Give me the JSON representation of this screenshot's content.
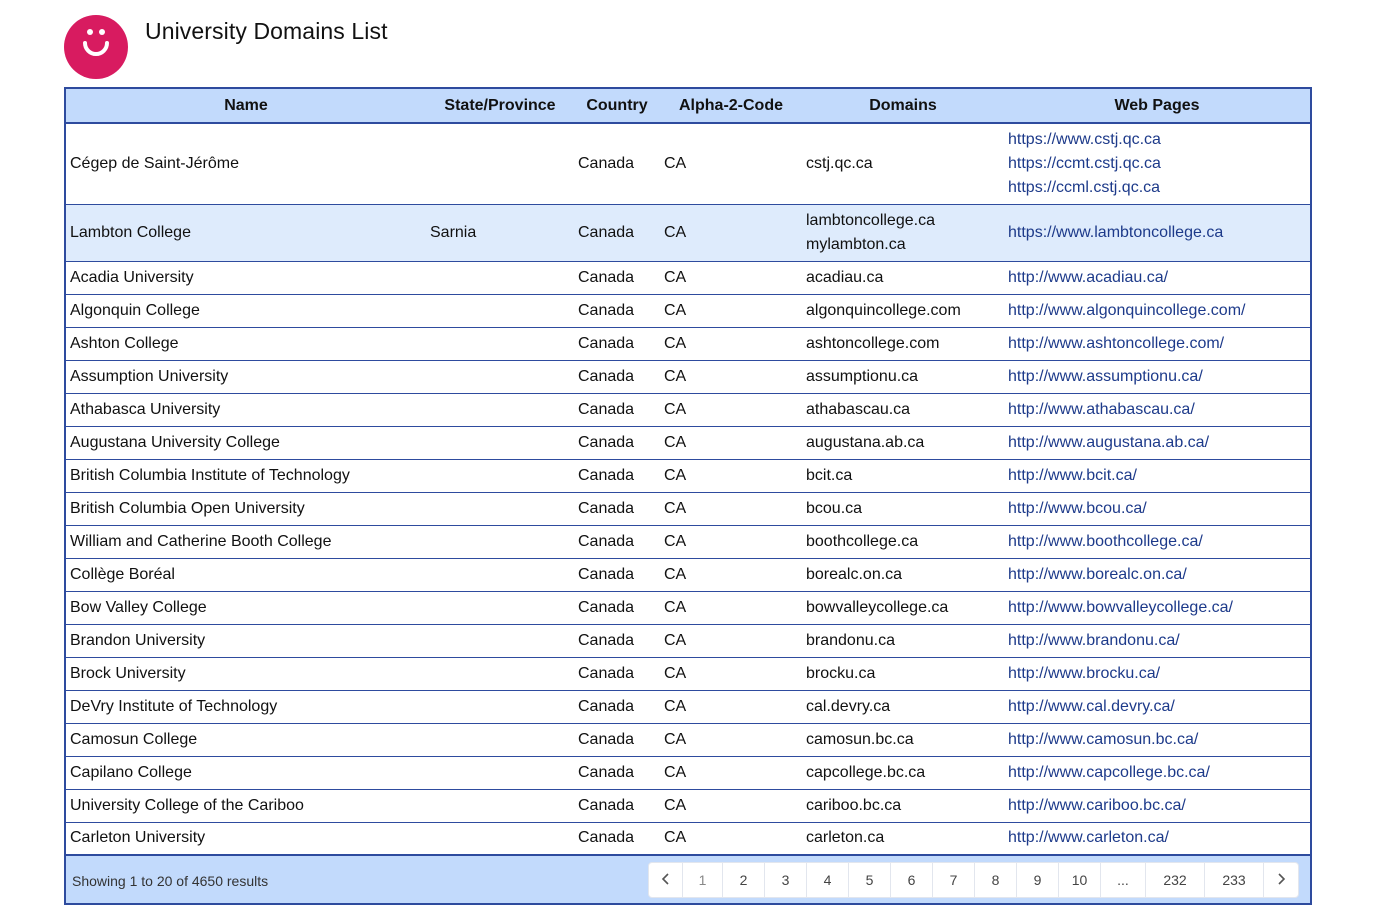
{
  "app": {
    "title": "University Domains List",
    "brand_color": "#d81b60"
  },
  "icons": {
    "logo": "smiley-logo-icon",
    "prev": "chevron-left-icon",
    "next": "chevron-right-icon"
  },
  "colors": {
    "header_bg": "#c2dafc",
    "border": "#2e4b9e",
    "highlight_row": "#deebfc",
    "link": "#1d3a8a"
  },
  "table": {
    "headers": [
      "Name",
      "State/Province",
      "Country",
      "Alpha-2-Code",
      "Domains",
      "Web Pages"
    ],
    "rows": [
      {
        "name": "Cégep de Saint-Jérôme",
        "state": "",
        "country": "Canada",
        "code": "CA",
        "domains": [
          "cstj.qc.ca"
        ],
        "web_pages": [
          "https://www.cstj.qc.ca",
          "https://ccmt.cstj.qc.ca",
          "https://ccml.cstj.qc.ca"
        ]
      },
      {
        "name": "Lambton College",
        "state": "Sarnia",
        "country": "Canada",
        "code": "CA",
        "domains": [
          "lambtoncollege.ca",
          "mylambton.ca"
        ],
        "web_pages": [
          "https://www.lambtoncollege.ca"
        ]
      },
      {
        "name": "Acadia University",
        "state": "",
        "country": "Canada",
        "code": "CA",
        "domains": [
          "acadiau.ca"
        ],
        "web_pages": [
          "http://www.acadiau.ca/"
        ]
      },
      {
        "name": "Algonquin College",
        "state": "",
        "country": "Canada",
        "code": "CA",
        "domains": [
          "algonquincollege.com"
        ],
        "web_pages": [
          "http://www.algonquincollege.com/"
        ]
      },
      {
        "name": "Ashton College",
        "state": "",
        "country": "Canada",
        "code": "CA",
        "domains": [
          "ashtoncollege.com"
        ],
        "web_pages": [
          "http://www.ashtoncollege.com/"
        ]
      },
      {
        "name": "Assumption University",
        "state": "",
        "country": "Canada",
        "code": "CA",
        "domains": [
          "assumptionu.ca"
        ],
        "web_pages": [
          "http://www.assumptionu.ca/"
        ]
      },
      {
        "name": "Athabasca University",
        "state": "",
        "country": "Canada",
        "code": "CA",
        "domains": [
          "athabascau.ca"
        ],
        "web_pages": [
          "http://www.athabascau.ca/"
        ]
      },
      {
        "name": "Augustana University College",
        "state": "",
        "country": "Canada",
        "code": "CA",
        "domains": [
          "augustana.ab.ca"
        ],
        "web_pages": [
          "http://www.augustana.ab.ca/"
        ]
      },
      {
        "name": "British Columbia Institute of Technology",
        "state": "",
        "country": "Canada",
        "code": "CA",
        "domains": [
          "bcit.ca"
        ],
        "web_pages": [
          "http://www.bcit.ca/"
        ]
      },
      {
        "name": "British Columbia Open University",
        "state": "",
        "country": "Canada",
        "code": "CA",
        "domains": [
          "bcou.ca"
        ],
        "web_pages": [
          "http://www.bcou.ca/"
        ]
      },
      {
        "name": "William and Catherine Booth College",
        "state": "",
        "country": "Canada",
        "code": "CA",
        "domains": [
          "boothcollege.ca"
        ],
        "web_pages": [
          "http://www.boothcollege.ca/"
        ]
      },
      {
        "name": "Collège Boréal",
        "state": "",
        "country": "Canada",
        "code": "CA",
        "domains": [
          "borealc.on.ca"
        ],
        "web_pages": [
          "http://www.borealc.on.ca/"
        ]
      },
      {
        "name": "Bow Valley College",
        "state": "",
        "country": "Canada",
        "code": "CA",
        "domains": [
          "bowvalleycollege.ca"
        ],
        "web_pages": [
          "http://www.bowvalleycollege.ca/"
        ]
      },
      {
        "name": "Brandon University",
        "state": "",
        "country": "Canada",
        "code": "CA",
        "domains": [
          "brandonu.ca"
        ],
        "web_pages": [
          "http://www.brandonu.ca/"
        ]
      },
      {
        "name": "Brock University",
        "state": "",
        "country": "Canada",
        "code": "CA",
        "domains": [
          "brocku.ca"
        ],
        "web_pages": [
          "http://www.brocku.ca/"
        ]
      },
      {
        "name": "DeVry Institute of Technology",
        "state": "",
        "country": "Canada",
        "code": "CA",
        "domains": [
          "cal.devry.ca"
        ],
        "web_pages": [
          "http://www.cal.devry.ca/"
        ]
      },
      {
        "name": "Camosun College",
        "state": "",
        "country": "Canada",
        "code": "CA",
        "domains": [
          "camosun.bc.ca"
        ],
        "web_pages": [
          "http://www.camosun.bc.ca/"
        ]
      },
      {
        "name": "Capilano College",
        "state": "",
        "country": "Canada",
        "code": "CA",
        "domains": [
          "capcollege.bc.ca"
        ],
        "web_pages": [
          "http://www.capcollege.bc.ca/"
        ]
      },
      {
        "name": "University College of the Cariboo",
        "state": "",
        "country": "Canada",
        "code": "CA",
        "domains": [
          "cariboo.bc.ca"
        ],
        "web_pages": [
          "http://www.cariboo.bc.ca/"
        ]
      },
      {
        "name": "Carleton University",
        "state": "",
        "country": "Canada",
        "code": "CA",
        "domains": [
          "carleton.ca"
        ],
        "web_pages": [
          "http://www.carleton.ca/"
        ]
      }
    ]
  },
  "footer": {
    "summary": "Showing 1 to 20 of 4650 results",
    "pages": [
      "1",
      "2",
      "3",
      "4",
      "5",
      "6",
      "7",
      "8",
      "9",
      "10",
      "...",
      "232",
      "233"
    ],
    "current_page": "1"
  }
}
